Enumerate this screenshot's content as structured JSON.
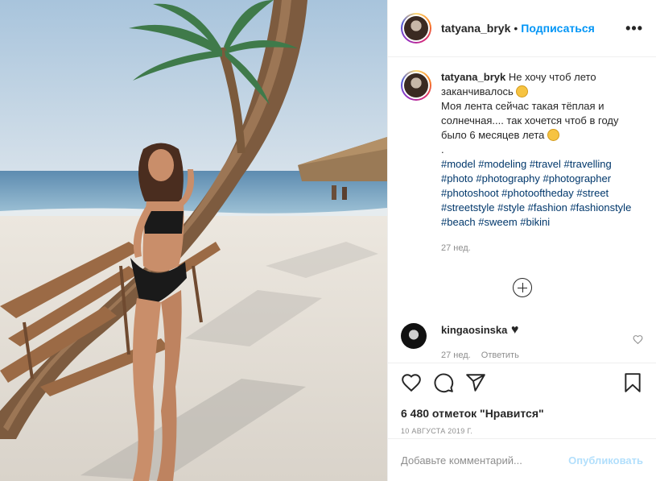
{
  "post": {
    "author": "tatyana_bryk",
    "follow_label": "Подписаться",
    "more_label": "•••",
    "caption_lines": [
      "Не хочу чтоб лето заканчивалось",
      "Моя лента сейчас такая тёплая и солнечная.... так хочется чтоб в году было 6 месяцев лета",
      "."
    ],
    "hashtags": "#model #modeling #travel #travelling #photo #photography #photographer #photoshoot #photooftheday #street #streetstyle #style #fashion #fashionstyle #beach #sweem #bikini",
    "caption_age": "27 нед."
  },
  "reply": {
    "author": "kingaosinska",
    "heart": "♥",
    "age": "27 нед.",
    "reply_label": "Ответить",
    "like_icon": "heart-outline-icon"
  },
  "likes_text": "6 480 отметок \"Нравится\"",
  "date_text": "10 АВГУСТА 2019 Г.",
  "comment_box": {
    "placeholder": "Добавьте комментарий...",
    "publish_label": "Опубликовать"
  },
  "colors": {
    "accent": "#0095f6",
    "hashtag": "#00376b",
    "muted": "#8e8e8e",
    "publish_disabled": "#b2dffc"
  }
}
